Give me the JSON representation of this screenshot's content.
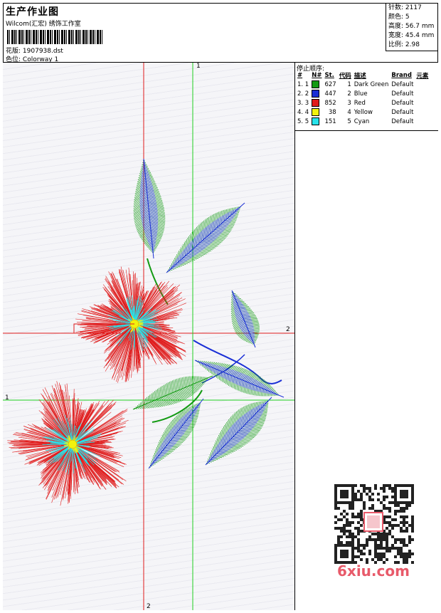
{
  "header": {
    "title": "生产作业图",
    "company": "Wilcom(汇宏) 绣饰工作室",
    "design_label": "花版:",
    "design_file": "1907938.dst",
    "colorway_label": "色位:",
    "colorway": "Colorway 1"
  },
  "stats": [
    {
      "label": "针数:",
      "value": "2117"
    },
    {
      "label": "颜色:",
      "value": "5"
    },
    {
      "label": "高度:",
      "value": "56.7 mm"
    },
    {
      "label": "宽度:",
      "value": "45.4 mm"
    },
    {
      "label": "比例:",
      "value": "2.98"
    }
  ],
  "stop_sequence": {
    "title": "停止顺序:",
    "columns": [
      "#",
      "N#",
      "St.",
      "代码",
      "描述",
      "Brand",
      "元素"
    ],
    "rows": [
      {
        "idx": "1. 1",
        "color": "#139a13",
        "stitches": "627",
        "code": "1",
        "desc": "Dark Green",
        "brand": "Default"
      },
      {
        "idx": "2. 2",
        "color": "#1a2fd6",
        "stitches": "447",
        "code": "2",
        "desc": "Blue",
        "brand": "Default"
      },
      {
        "idx": "3. 3",
        "color": "#e01b1b",
        "stitches": "852",
        "code": "3",
        "desc": "Red",
        "brand": "Default"
      },
      {
        "idx": "4. 4",
        "color": "#f2f20c",
        "stitches": "38",
        "code": "4",
        "desc": "Yellow",
        "brand": "Default"
      },
      {
        "idx": "5. 5",
        "color": "#27e2ea",
        "stitches": "151",
        "code": "5",
        "desc": "Cyan",
        "brand": "Default"
      }
    ]
  },
  "guides": {
    "top_green": "1",
    "right_red": "2",
    "left_green": "1",
    "bottom_red": "2"
  },
  "watermark": "6xiu.com",
  "colors": {
    "guide_red": "#e01b1b",
    "guide_green": "#20d020",
    "green": "#139a13",
    "blue": "#1a2fd6",
    "red": "#e01b1b",
    "yellow": "#f2f20c",
    "cyan": "#27e2ea"
  }
}
